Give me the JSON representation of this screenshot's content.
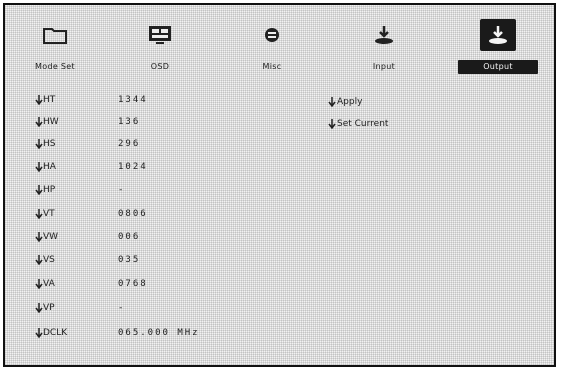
{
  "tabs": [
    {
      "label": "Mode Set",
      "icon": "folder-icon"
    },
    {
      "label": "OSD",
      "icon": "display-icon"
    },
    {
      "label": "Misc",
      "icon": "misc-icon"
    },
    {
      "label": "Input",
      "icon": "input-icon"
    },
    {
      "label": "Output",
      "icon": "output-icon",
      "active": true
    }
  ],
  "params": [
    {
      "key": "HT",
      "value": "1344"
    },
    {
      "key": "HW",
      "value": "136"
    },
    {
      "key": "HS",
      "value": "296"
    },
    {
      "key": "HA",
      "value": "1024"
    },
    {
      "key": "HP",
      "value": "-"
    },
    {
      "key": "VT",
      "value": "0806"
    },
    {
      "key": "VW",
      "value": "006"
    },
    {
      "key": "VS",
      "value": "035"
    },
    {
      "key": "VA",
      "value": "0768"
    },
    {
      "key": "VP",
      "value": "-"
    },
    {
      "key": "DCLK",
      "value": "065.000 MHz"
    }
  ],
  "actions": [
    {
      "label": "Apply"
    },
    {
      "label": "Set Current"
    }
  ]
}
